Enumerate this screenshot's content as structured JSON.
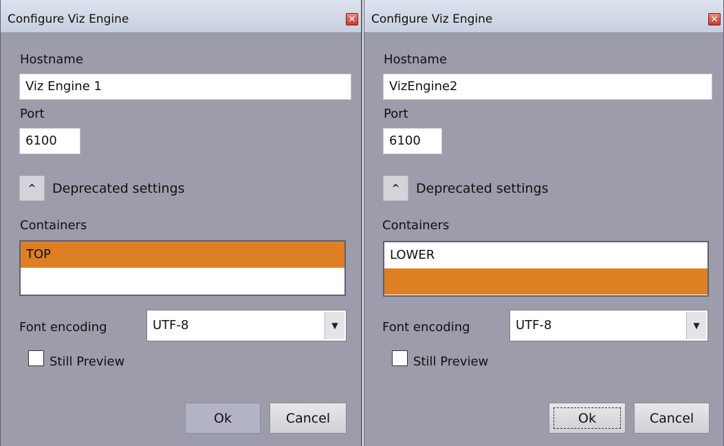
{
  "dialogs": [
    {
      "title": "Configure Viz Engine",
      "close_glyph": "✕",
      "hostname_label": "Hostname",
      "hostname_value": "Viz Engine 1",
      "port_label": "Port",
      "port_value": "6100",
      "expander_glyph": "^",
      "deprecated_label": "Deprecated settings",
      "containers_label": "Containers",
      "containers": [
        {
          "label": "TOP",
          "selected": true
        },
        {
          "label": "",
          "selected": false
        }
      ],
      "font_encoding_label": "Font encoding",
      "font_encoding_value": "UTF-8",
      "dropdown_glyph": "▼",
      "still_preview_label": "Still Preview",
      "still_preview_checked": false,
      "ok_label": "Ok",
      "cancel_label": "Cancel"
    },
    {
      "title": "Configure Viz Engine",
      "close_glyph": "✕",
      "hostname_label": "Hostname",
      "hostname_value": "VizEngine2",
      "port_label": "Port",
      "port_value": "6100",
      "expander_glyph": "^",
      "deprecated_label": "Deprecated settings",
      "containers_label": "Containers",
      "containers": [
        {
          "label": "LOWER",
          "selected": false
        },
        {
          "label": "",
          "selected": true
        }
      ],
      "font_encoding_label": "Font encoding",
      "font_encoding_value": "UTF-8",
      "dropdown_glyph": "▼",
      "still_preview_label": "Still Preview",
      "still_preview_checked": false,
      "ok_label": "Ok",
      "cancel_label": "Cancel"
    }
  ],
  "colors": {
    "dialog_background": "#9c9caa",
    "selection": "#df7f24"
  }
}
